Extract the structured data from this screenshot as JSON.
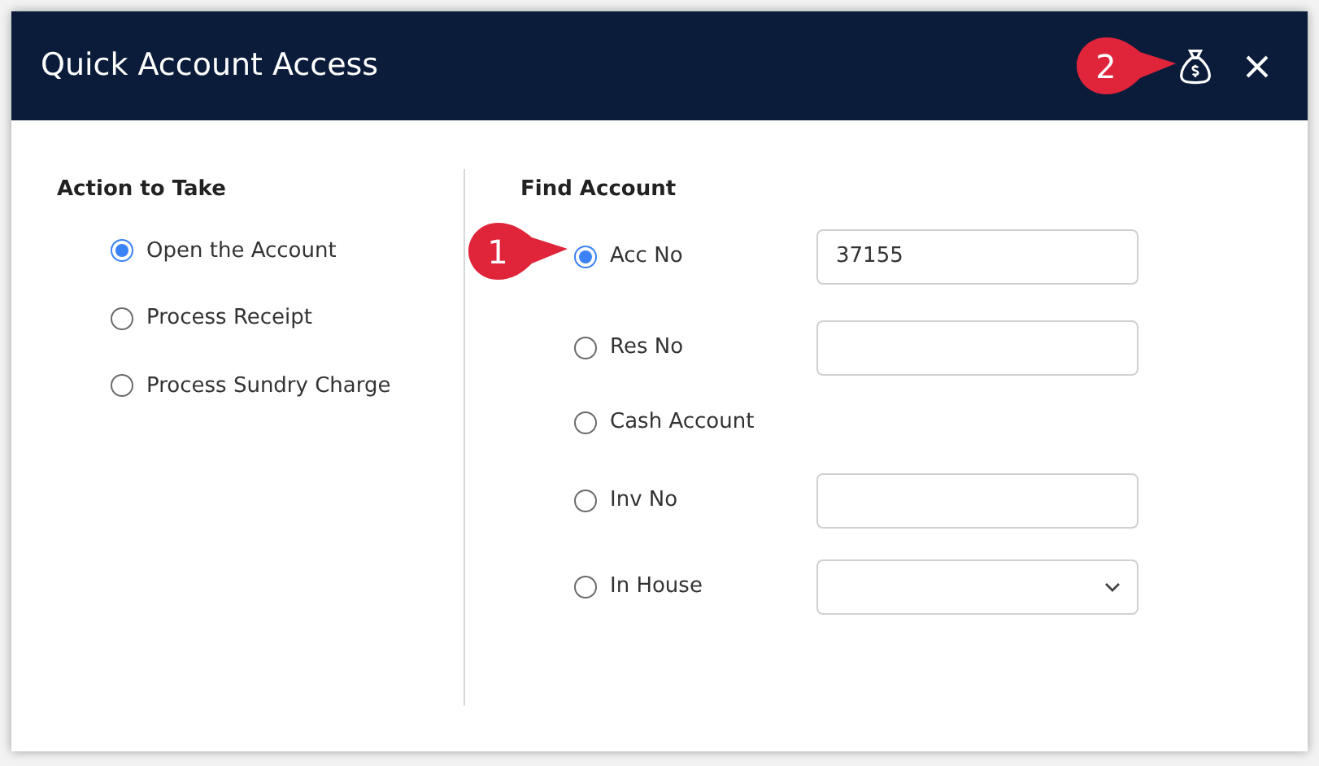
{
  "window": {
    "title": "Quick Account Access"
  },
  "callouts": [
    {
      "label": "1"
    },
    {
      "label": "2"
    }
  ],
  "action": {
    "heading": "Action to Take",
    "options": [
      {
        "label": "Open the Account",
        "selected": true
      },
      {
        "label": "Process Receipt",
        "selected": false
      },
      {
        "label": "Process Sundry Charge",
        "selected": false
      }
    ]
  },
  "find": {
    "heading": "Find Account",
    "options": [
      {
        "label": "Acc No",
        "selected": true,
        "kind": "text",
        "value": "37155"
      },
      {
        "label": "Res No",
        "selected": false,
        "kind": "text"
      },
      {
        "label": "Cash Account",
        "selected": false,
        "kind": "none"
      },
      {
        "label": "Inv No",
        "selected": false,
        "kind": "text"
      },
      {
        "label": "In House",
        "selected": false,
        "kind": "select"
      }
    ]
  }
}
